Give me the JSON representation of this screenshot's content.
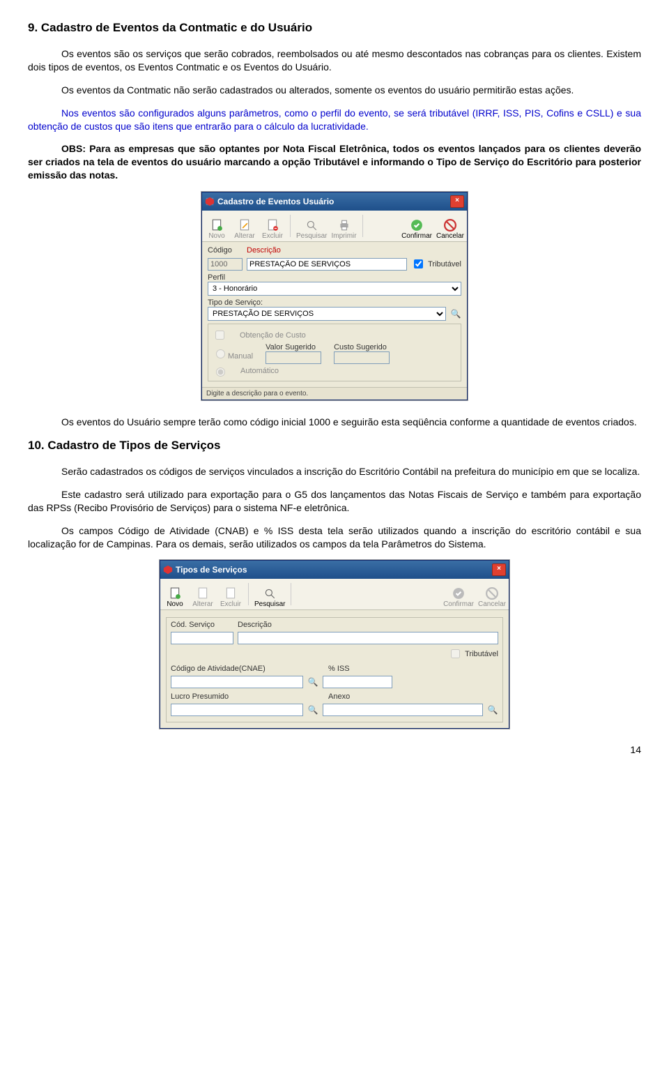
{
  "section9_title": "9. Cadastro de Eventos da Contmatic e do Usuário",
  "p1": "Os eventos são os serviços que serão cobrados, reembolsados ou até mesmo descontados nas cobranças para os clientes. Existem dois tipos de eventos, os Eventos Contmatic e os Eventos do Usuário.",
  "p2": "Os eventos da Contmatic não serão cadastrados ou alterados, somente os eventos do usuário permitirão estas ações.",
  "p3": "Nos eventos são configurados alguns parâmetros, como o perfil do evento,  se  será tributável (IRRF, ISS, PIS, Cofins e CSLL) e sua obtenção de custos que são itens que entrarão para o cálculo da lucratividade.",
  "p4a": "OBS: Para as empresas que são optantes por Nota Fiscal Eletrônica, todos os eventos lançados para os clientes deverão ser criados na tela de eventos do usuário marcando a opção Tributável e informando o Tipo de Serviço do Escritório para posterior emissão das notas.",
  "dialog1": {
    "title": "Cadastro de Eventos Usuário",
    "toolbar": {
      "novo": "Novo",
      "alterar": "Alterar",
      "excluir": "Excluir",
      "pesquisar": "Pesquisar",
      "imprimir": "Imprimir",
      "confirmar": "Confirmar",
      "cancelar": "Cancelar"
    },
    "labels": {
      "codigo": "Código",
      "descricao": "Descrição",
      "tributavel": "Tributável",
      "perfil": "Perfil",
      "tipo_servico": "Tipo de Serviço:",
      "obt_custo": "Obtenção de Custo",
      "manual": "Manual",
      "automatico": "Automático",
      "valor_sugerido": "Valor Sugerido",
      "custo_sugerido": "Custo Sugerido"
    },
    "values": {
      "codigo": "1000",
      "descricao": "PRESTAÇÃO DE SERVIÇOS",
      "perfil": "3 - Honorário",
      "tipo_servico": "PRESTAÇÃO DE SERVIÇOS"
    },
    "status": "Digite a descrição para o evento."
  },
  "p5": "Os eventos do Usuário sempre terão como código inicial 1000 e seguirão esta seqüência conforme a quantidade de eventos criados.",
  "section10_title": "10. Cadastro de Tipos de Serviços",
  "p6": "Serão cadastrados os códigos de serviços vinculados a inscrição do Escritório Contábil na prefeitura do município em que se localiza.",
  "p7": "Este cadastro será utilizado para exportação para o G5 dos lançamentos das Notas Fiscais de Serviço e também para exportação das RPSs (Recibo Provisório de Serviços) para o sistema NF-e eletrônica.",
  "p8": "Os campos Código de Atividade (CNAB) e % ISS desta tela serão utilizados quando a inscrição do escritório contábil e sua localização for de Campinas. Para os demais, serão utilizados os campos da tela Parâmetros do Sistema.",
  "dialog2": {
    "title": "Tipos de Serviços",
    "toolbar": {
      "novo": "Novo",
      "alterar": "Alterar",
      "excluir": "Excluir",
      "pesquisar": "Pesquisar",
      "confirmar": "Confirmar",
      "cancelar": "Cancelar"
    },
    "labels": {
      "cod_servico": "Cód. Serviço",
      "descricao": "Descrição",
      "tributavel": "Tributável",
      "cod_atividade": "Código de Atividade(CNAE)",
      "iss": "% ISS",
      "lucro_presumido": "Lucro Presumido",
      "anexo": "Anexo"
    }
  },
  "page_number": "14"
}
